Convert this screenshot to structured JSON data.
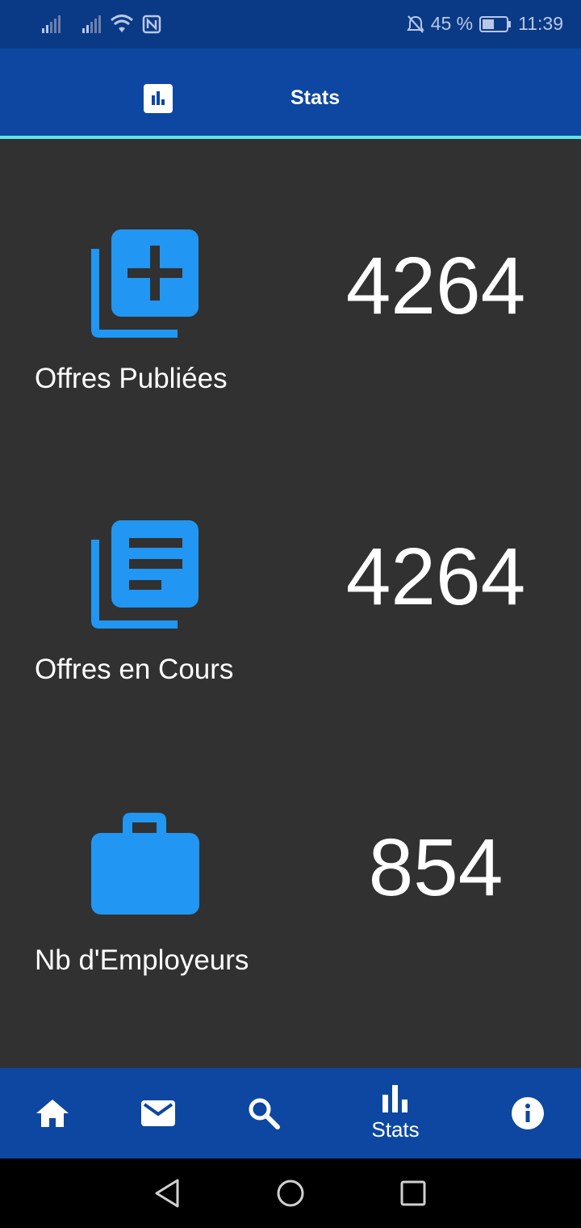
{
  "status_bar": {
    "battery_percent": "45 %",
    "time": "11:39"
  },
  "app_bar": {
    "title": "Stats",
    "icon": "bar-chart-icon"
  },
  "stats": [
    {
      "icon": "library-add-icon",
      "value": "4264",
      "label": "Offres Publiées"
    },
    {
      "icon": "library-books-icon",
      "value": "4264",
      "label": "Offres en Cours"
    },
    {
      "icon": "briefcase-icon",
      "value": "854",
      "label": "Nb d'Employeurs"
    }
  ],
  "bottom_nav": {
    "items": [
      {
        "icon": "home-icon",
        "label": ""
      },
      {
        "icon": "mail-icon",
        "label": ""
      },
      {
        "icon": "search-icon",
        "label": ""
      },
      {
        "icon": "bar-chart-icon",
        "label": "Stats",
        "active": true
      },
      {
        "icon": "info-icon",
        "label": ""
      }
    ]
  },
  "colors": {
    "primary": "#0d47a1",
    "accent_icon": "#2196f3",
    "indicator": "#5ee6e6",
    "background": "#313131"
  }
}
